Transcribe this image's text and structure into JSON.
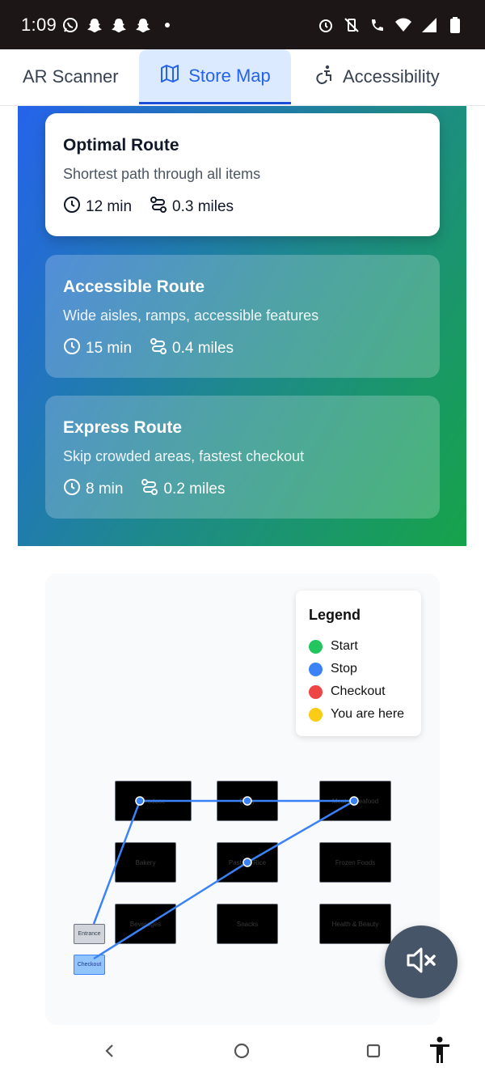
{
  "status_bar": {
    "time": "1:09",
    "left_icons": [
      "whatsapp-icon",
      "snapchat-icon",
      "snapchat-icon",
      "snapchat-icon",
      "dot-icon"
    ],
    "right_icons": [
      "alarm-icon",
      "vibrate-off-icon",
      "wifi-call-icon",
      "wifi-icon",
      "signal-icon",
      "battery-icon"
    ]
  },
  "tabs": [
    {
      "label": "AR Scanner",
      "icon": "",
      "active": false
    },
    {
      "label": "Store Map",
      "icon": "map-icon",
      "active": true
    },
    {
      "label": "Accessibility",
      "icon": "accessibility-icon",
      "active": false
    }
  ],
  "routes": [
    {
      "title": "Optimal Route",
      "description": "Shortest path through all items",
      "time": "12 min",
      "distance": "0.3 miles",
      "selected": true
    },
    {
      "title": "Accessible Route",
      "description": "Wide aisles, ramps, accessible features",
      "time": "15 min",
      "distance": "0.4 miles",
      "selected": false
    },
    {
      "title": "Express Route",
      "description": "Skip crowded areas, fastest checkout",
      "time": "8 min",
      "distance": "0.2 miles",
      "selected": false
    }
  ],
  "legend": {
    "title": "Legend",
    "items": [
      {
        "label": "Start",
        "color": "#22c55e"
      },
      {
        "label": "Stop",
        "color": "#3b82f6"
      },
      {
        "label": "Checkout",
        "color": "#ef4444"
      },
      {
        "label": "You are here",
        "color": "#facc15"
      }
    ]
  },
  "map": {
    "aisles": [
      "Produce",
      "Dairy",
      "Meat & Seafood",
      "Bakery",
      "Pasta & Rice",
      "Frozen Foods",
      "Beverages",
      "Snacks",
      "Health & Beauty"
    ],
    "entrance_label": "Entrance",
    "checkout_label": "Checkout"
  },
  "colors": {
    "accent": "#2563eb",
    "gradient_start": "#2563eb",
    "gradient_end": "#16a34a",
    "route_line": "#3b82f6"
  },
  "fab": {
    "icon": "volume-mute-icon"
  },
  "nav_bar": {
    "icons": [
      "back-icon",
      "home-icon",
      "recents-icon",
      "accessibility-person-icon"
    ]
  }
}
